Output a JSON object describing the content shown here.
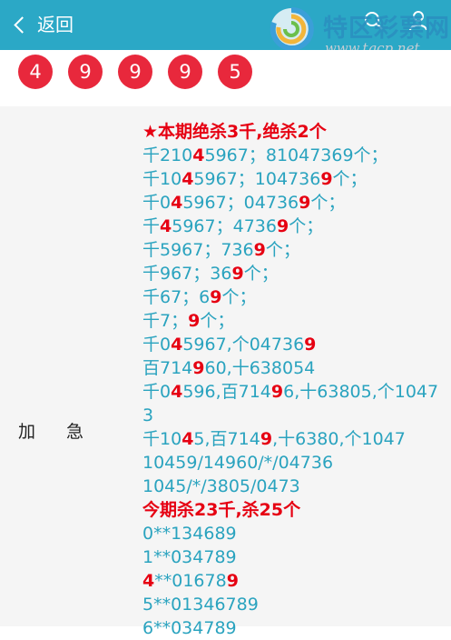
{
  "header": {
    "back_label": "返回",
    "logo": {
      "name": "特区彩票网",
      "url": "www.tqcp.net"
    },
    "colors": {
      "bar": "#2ba8c6",
      "highlight": "#e60012",
      "text": "#2aa3bf"
    }
  },
  "balls": [
    "4",
    "9",
    "9",
    "9",
    "5"
  ],
  "section": {
    "label_1": "加",
    "label_2": "急"
  },
  "lines": [
    {
      "type": "title",
      "segments": [
        "★本期绝杀3千",
        "绝杀2个"
      ]
    },
    {
      "segments": [
        "千210",
        "4",
        "5967；81047369个；"
      ]
    },
    {
      "segments": [
        "千10",
        "4",
        "5967；104736",
        "9",
        "个；"
      ]
    },
    {
      "segments": [
        "千0",
        "4",
        "5967；04736",
        "9",
        "个；"
      ]
    },
    {
      "segments": [
        "千",
        "4",
        "5967；4736",
        "9",
        "个；"
      ]
    },
    {
      "segments": [
        "千5967；736",
        "9",
        "个；"
      ]
    },
    {
      "segments": [
        "千967；36",
        "9",
        "个；"
      ]
    },
    {
      "segments": [
        "千67；6",
        "9",
        "个；"
      ]
    },
    {
      "segments": [
        "千7；",
        "9",
        "个；"
      ]
    },
    {
      "segments": [
        "千0",
        "4",
        "5967,个04736",
        "9",
        ""
      ]
    },
    {
      "segments": [
        "百714",
        "9",
        "60,十638054"
      ]
    },
    {
      "segments": [
        "千0",
        "4",
        "596,百714",
        "9",
        "6,十63805,个10473"
      ]
    },
    {
      "segments": [
        "千10",
        "4",
        "5,百714",
        "9",
        ",十6380,个1047"
      ]
    },
    {
      "segments": [
        "10459/14960/*/04736"
      ]
    },
    {
      "segments": [
        "1045/*/3805/0473"
      ]
    },
    {
      "type": "title",
      "segments": [
        "今期杀23千",
        "杀25个"
      ]
    },
    {
      "segments": [
        "0**134689"
      ]
    },
    {
      "segments": [
        "1**034789"
      ]
    },
    {
      "segments": [
        "4",
        "**01678",
        "9",
        ""
      ]
    },
    {
      "segments": [
        "5**01346789"
      ]
    },
    {
      "segments": [
        "6**034789"
      ]
    }
  ]
}
